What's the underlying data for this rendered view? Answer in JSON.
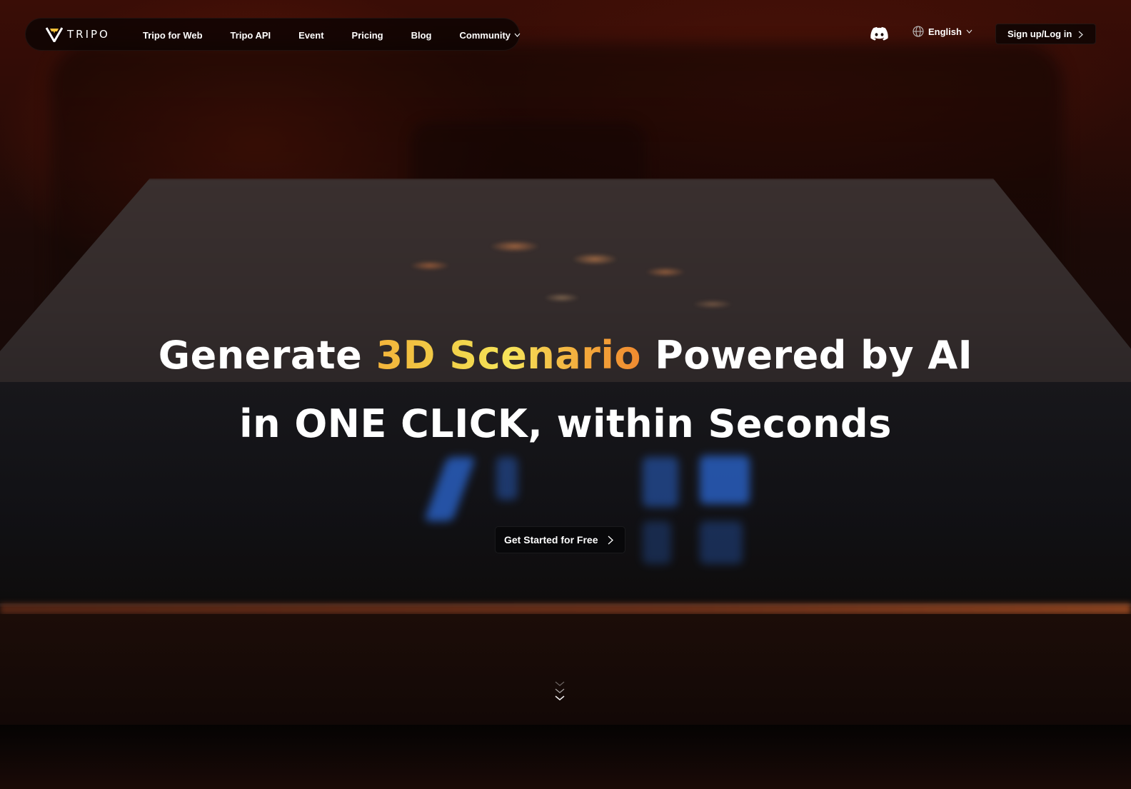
{
  "brand": {
    "name": "TRIPO",
    "accent": "#f3c13a"
  },
  "nav": {
    "links": [
      {
        "label": "Tripo for Web"
      },
      {
        "label": "Tripo API"
      },
      {
        "label": "Event"
      },
      {
        "label": "Pricing"
      },
      {
        "label": "Blog"
      },
      {
        "label": "Community",
        "has_dropdown": true
      }
    ],
    "discord_icon": "discord-icon",
    "language": {
      "icon": "globe-icon",
      "selected": "English"
    },
    "login_label": "Sign up/Log in"
  },
  "hero": {
    "line1_pre": "Generate ",
    "line1_accent": "3D Scenario",
    "line1_post": " Powered by AI",
    "line2": "in ONE CLICK, within Seconds",
    "cta_label": "Get Started for Free",
    "scroll_icon": "triple-chevron-down-icon"
  }
}
